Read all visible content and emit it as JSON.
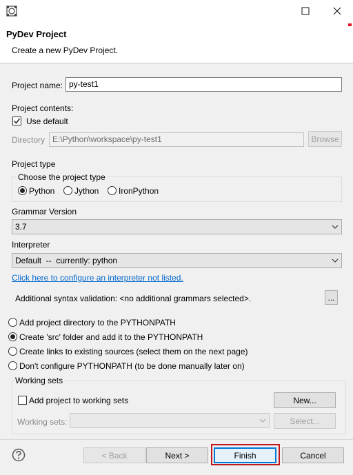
{
  "window": {
    "title": ""
  },
  "header": {
    "title": "PyDev Project",
    "subtitle": "Create a new PyDev Project."
  },
  "project_name": {
    "label": "Project name:",
    "value": "py-test1"
  },
  "project_contents": {
    "label": "Project contents:",
    "use_default_label": "Use default",
    "use_default_checked": true,
    "directory_label": "Directory",
    "directory_value": "E:\\Python\\workspace\\py-test1",
    "browse_label": "Browse"
  },
  "project_type": {
    "label": "Project type",
    "group_label": "Choose the project type",
    "options": [
      "Python",
      "Jython",
      "IronPython"
    ],
    "selected": "Python"
  },
  "grammar": {
    "label": "Grammar Version",
    "value": "3.7"
  },
  "interpreter": {
    "label": "Interpreter",
    "value": "Default  --  currently: python",
    "configure_link": "Click here to configure an interpreter not listed."
  },
  "syntax_validation": {
    "label": "Additional syntax validation: <no additional grammars selected>.",
    "button_label": "..."
  },
  "pythonpath": {
    "options": [
      "Add project directory to the PYTHONPATH",
      "Create 'src' folder and add it to the PYTHONPATH",
      "Create links to existing sources (select them on the next page)",
      "Don't configure PYTHONPATH (to be done manually later on)"
    ],
    "selected_index": 1
  },
  "working_sets": {
    "group_label": "Working sets",
    "add_label": "Add project to working sets",
    "add_checked": false,
    "new_label": "New...",
    "sets_label": "Working sets:",
    "sets_value": "",
    "select_label": "Select..."
  },
  "footer": {
    "help_icon": "question-icon",
    "back_label": "< Back",
    "next_label": "Next >",
    "finish_label": "Finish",
    "cancel_label": "Cancel"
  },
  "colors": {
    "highlight_border": "#c0161c",
    "link": "#0066cc",
    "default_button": "#0078d7"
  }
}
